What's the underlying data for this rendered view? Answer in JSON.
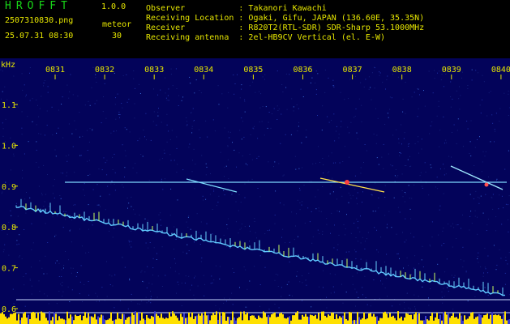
{
  "header": {
    "logo": "HROFFT",
    "version": "1.0.0",
    "filename": "2507310830.png",
    "datetime": "25.07.31 08:30",
    "meteor_label": "meteor",
    "meteor_count": "30",
    "info_rows": [
      "Observer           : Takanori Kawachi",
      "Receiving Location : Ogaki, Gifu, JAPAN (136.60E, 35.35N)",
      "Receiver           : R820T2(RTL-SDR) SDR-Sharp 53.1000MHz",
      "Receiving antenna  : 2el-HB9CV Vertical (el. E-W)"
    ]
  },
  "spectrogram": {
    "y_unit": "kHz",
    "x_ticks": [
      "0831",
      "0832",
      "0833",
      "0834",
      "0835",
      "0836",
      "0837",
      "0838",
      "0839",
      "0840"
    ],
    "y_ticks": [
      "1.1",
      "1.0",
      "0.9",
      "0.8",
      "0.7",
      "0.6"
    ],
    "colors": {
      "background": "#03035a",
      "axis_text": "#e6e600",
      "tick": "#e6e600",
      "trace": "#5fc8ff",
      "carrier": "#7fd8ff",
      "noise_strip": "#ffe000"
    }
  }
}
